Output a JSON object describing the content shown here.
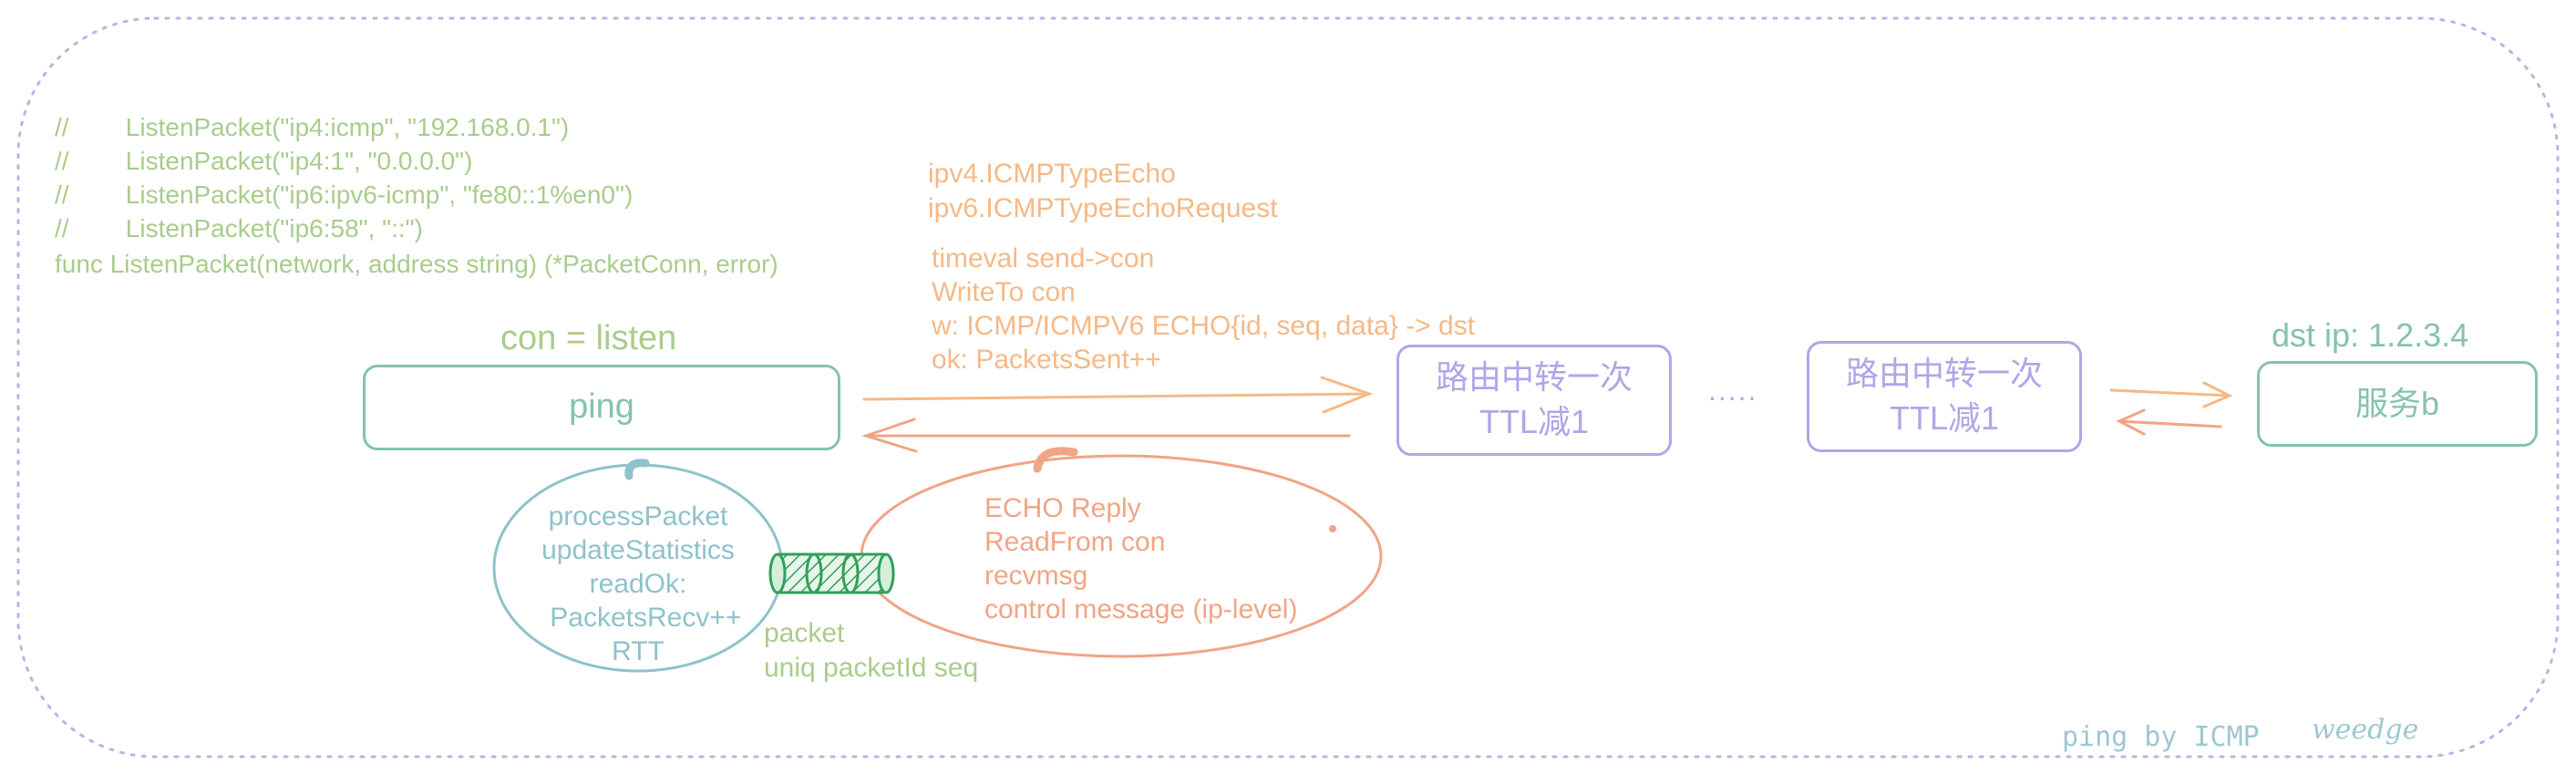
{
  "code": {
    "comments": [
      "//        ListenPacket(\"ip4:icmp\", \"192.168.0.1\")",
      "//        ListenPacket(\"ip4:1\", \"0.0.0.0\")",
      "//        ListenPacket(\"ip6:ipv6-icmp\", \"fe80::1%en0\")",
      "//        ListenPacket(\"ip6:58\", \"::\")"
    ],
    "signature": "func ListenPacket(network, address string) (*PacketConn, error)"
  },
  "con_label": "con = listen",
  "nodes": {
    "ping": "ping",
    "router1": [
      "路由中转一次",
      "TTL减1"
    ],
    "router2": [
      "路由中转一次",
      "TTL减1"
    ],
    "ellipsis": ".....",
    "dst_label": "dst ip: 1.2.3.4",
    "server": "服务b"
  },
  "echo_types": [
    "ipv4.ICMPTypeEcho",
    "ipv6.ICMPTypeEchoRequest"
  ],
  "send_steps": [
    "timeval send->con",
    "WriteTo con",
    "w: ICMP/ICMPV6 ECHO{id, seq, data} -> dst",
    "ok: PacketsSent++"
  ],
  "process_steps": [
    "processPacket",
    "updateStatistics",
    "readOk:",
    "  PacketsRecv++",
    "RTT"
  ],
  "receive_steps": [
    "ECHO Reply",
    "ReadFrom con",
    "recvmsg",
    "control message (ip-level)"
  ],
  "packet_notes": [
    "packet",
    "uniq packetId seq"
  ],
  "footer": {
    "title": "ping by ICMP",
    "signature": "weedge"
  },
  "colors": {
    "border": "#b9b4e6",
    "green_text": "#a9cc8c",
    "teal_box": "#86c2ad",
    "orange": "#f5b987",
    "salmon": "#f0a585",
    "blue": "#8fc2cb",
    "purple": "#b3a4e8",
    "hatch": "#2fa05a"
  }
}
